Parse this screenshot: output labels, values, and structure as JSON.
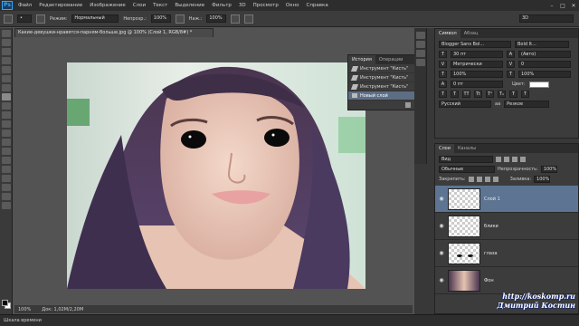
{
  "app": {
    "logo": "Ps"
  },
  "menu": [
    "Файл",
    "Редактирование",
    "Изображение",
    "Слои",
    "Текст",
    "Выделение",
    "Фильтр",
    "3D",
    "Просмотр",
    "Окно",
    "Справка"
  ],
  "window_controls": [
    "–",
    "□",
    "✕"
  ],
  "options": {
    "mode_label": "Режим:",
    "mode_value": "Нормальный",
    "opacity_label": "Непрозр.:",
    "opacity_value": "100%",
    "pressure_label": "Наж.:",
    "pressure_value": "100%",
    "workspace": "3D"
  },
  "document": {
    "tab_title": "Какие-девушки-нравятся-парням-больше.jpg @ 100% (Слой 1, RGB/8#) *",
    "zoom": "100%",
    "doc_info": "Док: 1,02M/2,20M"
  },
  "timeline": {
    "label": "Шкала времени"
  },
  "history": {
    "tabs": [
      "История",
      "Операции"
    ],
    "items": [
      {
        "label": "Инструмент \"Кисть\"",
        "icon": "brush-icon"
      },
      {
        "label": "Инструмент \"Кисть\"",
        "icon": "brush-icon"
      },
      {
        "label": "Инструмент \"Кисть\"",
        "icon": "brush-icon"
      },
      {
        "label": "Новый слой",
        "icon": "new-layer-icon"
      }
    ]
  },
  "character": {
    "tabs": [
      "Символ",
      "Абзац"
    ],
    "font_family": "Blogger Sans Bol...",
    "font_style": "Bold It...",
    "font_size": "30 пт",
    "leading": "(Авто)",
    "kerning": "Метрически",
    "tracking": "0",
    "vscale": "100%",
    "hscale": "100%",
    "baseline": "0 пт",
    "color_label": "Цвет:",
    "color_value": "#ffffff",
    "format_buttons": [
      "T",
      "T",
      "TT",
      "Tt",
      "T¹",
      "T₁",
      "T",
      "T"
    ],
    "language": "Русский",
    "aa_label": "aa",
    "aa_value": "Резкое"
  },
  "layers": {
    "tabs": [
      "Слои",
      "Каналы"
    ],
    "filter_label": "Вид",
    "blend_mode": "Обычные",
    "opacity_label": "Непрозрачность:",
    "opacity_value": "100%",
    "lock_label": "Закрепить:",
    "fill_label": "Заливка:",
    "fill_value": "100%",
    "items": [
      {
        "name": "Слой 1",
        "selected": true
      },
      {
        "name": "блики",
        "selected": false
      },
      {
        "name": "глаза",
        "selected": false
      },
      {
        "name": "Фон",
        "selected": false
      }
    ]
  },
  "watermark": {
    "url": "http://koskomp.ru",
    "author": "Дмитрий Костин"
  }
}
